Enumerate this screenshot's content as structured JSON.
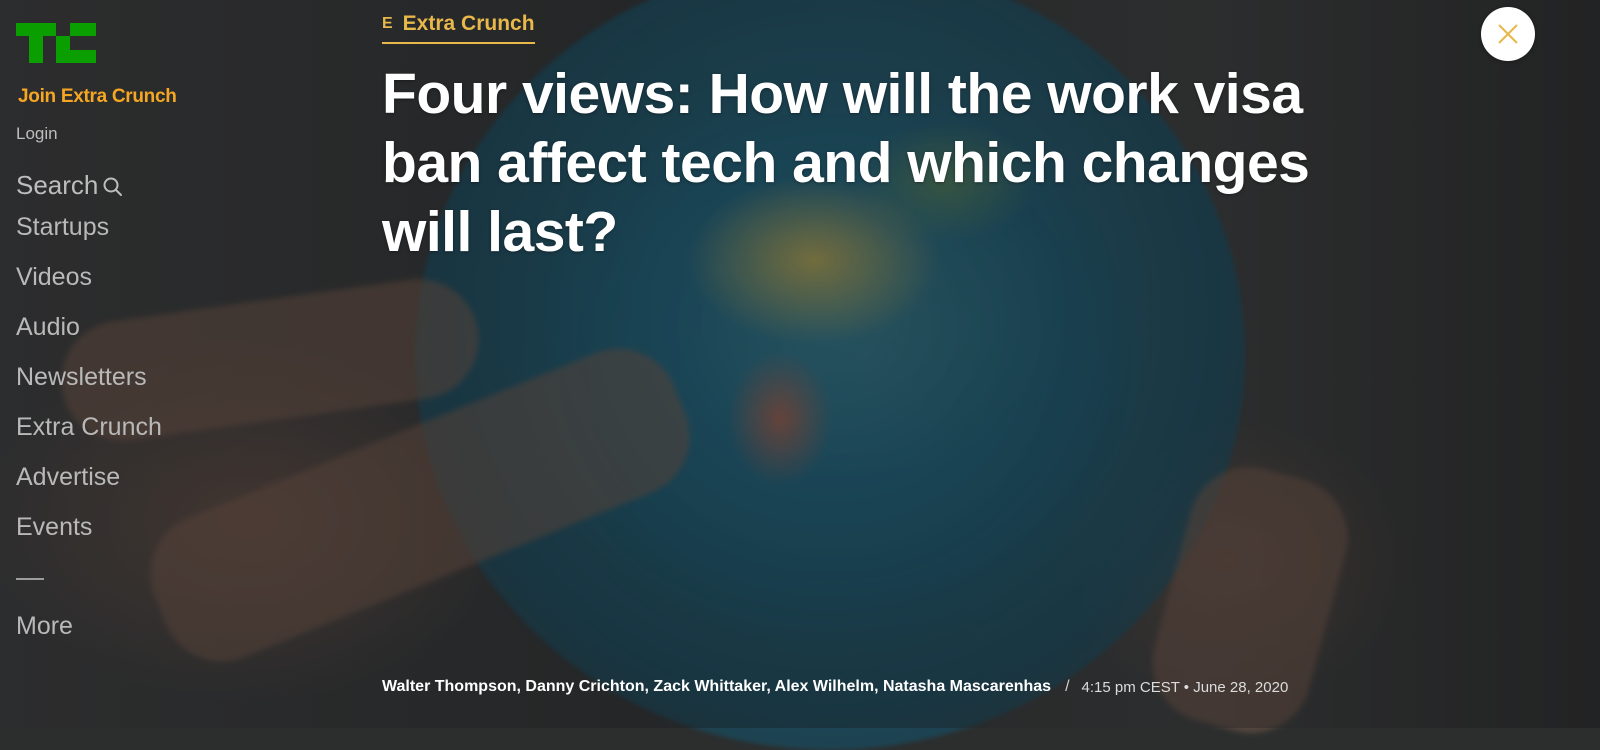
{
  "sidebar": {
    "join_label": "Join Extra Crunch",
    "login_label": "Login",
    "search_label": "Search",
    "nav_items": [
      {
        "label": "Startups"
      },
      {
        "label": "Videos"
      },
      {
        "label": "Audio"
      },
      {
        "label": "Newsletters"
      },
      {
        "label": "Extra Crunch"
      },
      {
        "label": "Advertise"
      },
      {
        "label": "Events"
      }
    ],
    "more_label": "More"
  },
  "article": {
    "category": "Extra Crunch",
    "category_icon": "extra-crunch-icon",
    "title": "Four views: How will the work visa ban affect tech and which changes will last?",
    "authors": "Walter Thompson, Danny Crichton, Zack Whittaker, Alex Wilhelm, Natasha Mascarenhas",
    "separator": "/",
    "timestamp": "4:15 pm CEST • June 28, 2020"
  },
  "icons": {
    "logo": "techcrunch-logo",
    "search": "search-icon",
    "close": "close-icon"
  },
  "colors": {
    "logo_green": "#0a9e01",
    "extra_crunch_orange": "#f5a623",
    "category_gold": "#e8b84a",
    "close_x": "#e8b84a"
  }
}
